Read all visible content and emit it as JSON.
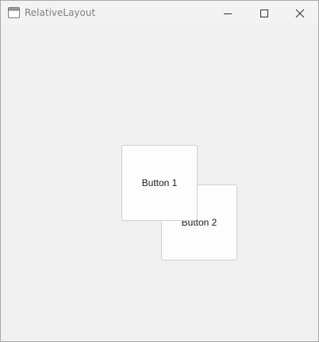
{
  "window": {
    "title": "RelativeLayout",
    "controls": {
      "minimize": "minimize",
      "maximize": "maximize",
      "close": "close"
    }
  },
  "buttons": {
    "button1": "Button 1",
    "button2": "Button 2"
  },
  "icons": {
    "app": "window-app-icon",
    "minimize": "minimize-icon",
    "maximize": "maximize-icon",
    "close": "close-icon"
  }
}
